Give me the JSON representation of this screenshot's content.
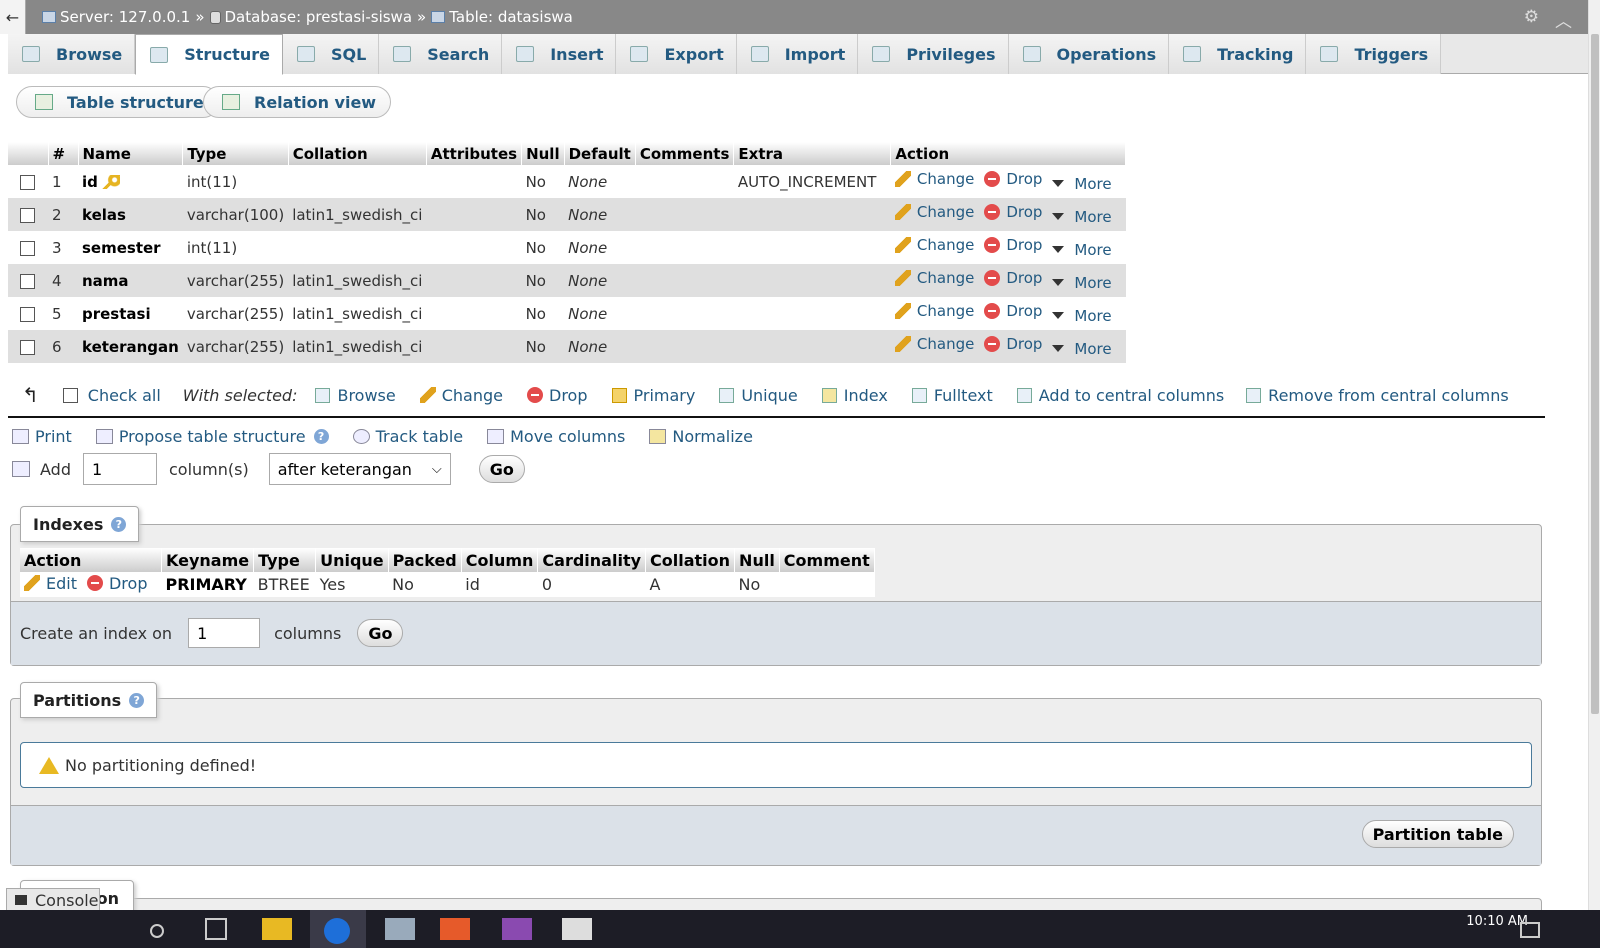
{
  "breadcrumb": {
    "server": "Server: 127.0.0.1",
    "database": "Database: prestasi-siswa",
    "table": "Table: datasiswa",
    "sep": "»"
  },
  "tabs": [
    {
      "label": "Browse",
      "active": false
    },
    {
      "label": "Structure",
      "active": true
    },
    {
      "label": "SQL",
      "active": false
    },
    {
      "label": "Search",
      "active": false
    },
    {
      "label": "Insert",
      "active": false
    },
    {
      "label": "Export",
      "active": false
    },
    {
      "label": "Import",
      "active": false
    },
    {
      "label": "Privileges",
      "active": false
    },
    {
      "label": "Operations",
      "active": false
    },
    {
      "label": "Tracking",
      "active": false
    },
    {
      "label": "Triggers",
      "active": false
    }
  ],
  "subtabs": {
    "table_structure": "Table structure",
    "relation_view": "Relation view"
  },
  "structure": {
    "headers": [
      "#",
      "Name",
      "Type",
      "Collation",
      "Attributes",
      "Null",
      "Default",
      "Comments",
      "Extra",
      "Action"
    ],
    "rows": [
      {
        "num": "1",
        "name": "id",
        "type": "int(11)",
        "collation": "",
        "null": "No",
        "default": "None",
        "extra": "AUTO_INCREMENT"
      },
      {
        "num": "2",
        "name": "kelas",
        "type": "varchar(100)",
        "collation": "latin1_swedish_ci",
        "null": "No",
        "default": "None",
        "extra": ""
      },
      {
        "num": "3",
        "name": "semester",
        "type": "int(11)",
        "collation": "",
        "null": "No",
        "default": "None",
        "extra": ""
      },
      {
        "num": "4",
        "name": "nama",
        "type": "varchar(255)",
        "collation": "latin1_swedish_ci",
        "null": "No",
        "default": "None",
        "extra": ""
      },
      {
        "num": "5",
        "name": "prestasi",
        "type": "varchar(255)",
        "collation": "latin1_swedish_ci",
        "null": "No",
        "default": "None",
        "extra": ""
      },
      {
        "num": "6",
        "name": "keterangan",
        "type": "varchar(255)",
        "collation": "latin1_swedish_ci",
        "null": "No",
        "default": "None",
        "extra": ""
      }
    ],
    "actions": {
      "change": "Change",
      "drop": "Drop",
      "more": "More"
    }
  },
  "with_selected": {
    "check_all": "Check all",
    "label": "With selected:",
    "items": [
      "Browse",
      "Change",
      "Drop",
      "Primary",
      "Unique",
      "Index",
      "Fulltext",
      "Add to central columns",
      "Remove from central columns"
    ]
  },
  "tools": {
    "print": "Print",
    "propose": "Propose table structure",
    "track": "Track table",
    "move": "Move columns",
    "normalize": "Normalize"
  },
  "add_column": {
    "add": "Add",
    "count": "1",
    "columns_label": "column(s)",
    "position": "after keterangan",
    "go": "Go"
  },
  "indexes": {
    "legend": "Indexes",
    "headers": [
      "Action",
      "Keyname",
      "Type",
      "Unique",
      "Packed",
      "Column",
      "Cardinality",
      "Collation",
      "Null",
      "Comment"
    ],
    "row": {
      "edit": "Edit",
      "drop": "Drop",
      "keyname": "PRIMARY",
      "type": "BTREE",
      "unique": "Yes",
      "packed": "No",
      "column": "id",
      "cardinality": "0",
      "collation": "A",
      "null": "No",
      "comment": ""
    },
    "create_label": "Create an index on",
    "create_count": "1",
    "columns_label": "columns",
    "go": "Go"
  },
  "partitions": {
    "legend": "Partitions",
    "message": "No partitioning defined!",
    "button": "Partition table"
  },
  "next_legend_tail": "on",
  "console": "Console",
  "clock": "10:10 AM",
  "colors": {
    "link": "#235a81",
    "topbar": "#888888",
    "row_alt": "#dfdfdf"
  }
}
